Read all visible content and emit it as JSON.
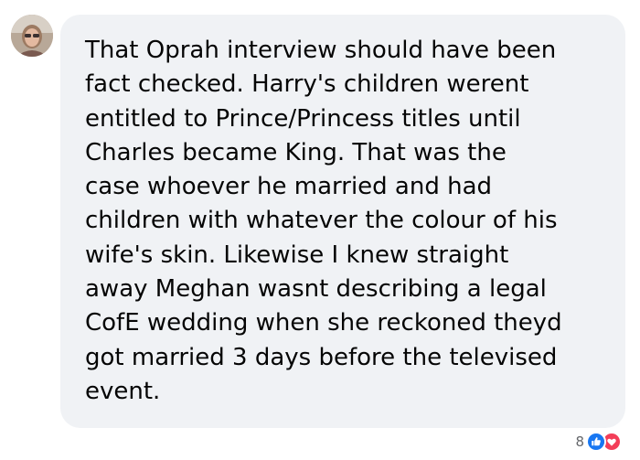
{
  "comment": {
    "text": "That Oprah interview should have been\nfact checked. Harry's children werent\nentitled to Prince/Princess titles until\nCharles became King. That was the\ncase whoever he married and had\nchildren with whatever the colour of his\nwife's skin. Likewise I knew straight\naway Meghan wasnt describing a legal\nCofE wedding when she reckoned theyd\ngot married 3 days before the televised\nevent."
  },
  "reactions": {
    "count": "8",
    "icons": [
      "like-icon",
      "love-icon"
    ],
    "colors": {
      "like": "#1877f2",
      "love": "#f33e58"
    }
  },
  "colors": {
    "bubble": "#f0f2f5",
    "text": "#050505",
    "meta": "#65676b"
  }
}
